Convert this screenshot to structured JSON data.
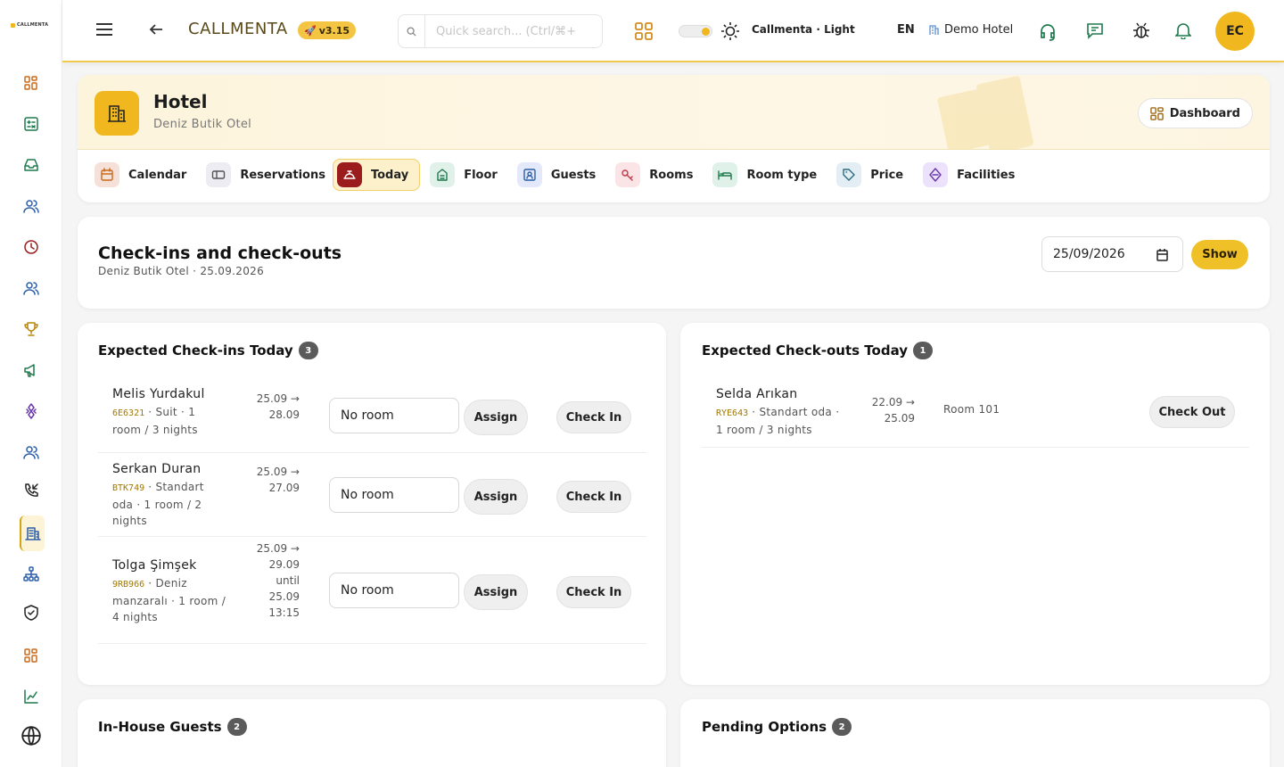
{
  "app": {
    "brand": "CALLMENTA",
    "version": "v3.15",
    "logo_text": "CALLMENTA"
  },
  "topbar": {
    "search_placeholder": "Quick search... (Ctrl/⌘+",
    "theme_label": "Callmenta · Light",
    "language": "EN",
    "hotel_label": "Demo Hotel",
    "avatar_initials": "EC",
    "icons": [
      "menu-icon",
      "back-arrow-icon",
      "search-icon",
      "apps-grid-icon",
      "theme-toggle",
      "sun-icon",
      "building-icon",
      "headset-icon",
      "chat-icon",
      "bug-icon",
      "bell-icon"
    ]
  },
  "sidebar": {
    "items": [
      "dashboard-icon",
      "spreadsheet-icon",
      "inbox-icon",
      "users-icon",
      "clock-icon",
      "team-icon",
      "trophy-icon",
      "megaphone-icon",
      "integration-icon",
      "contacts-icon",
      "phone-incoming-icon",
      "hotel-icon",
      "org-chart-icon",
      "shield-icon",
      "grid-icon",
      "chart-icon",
      "globe-icon"
    ],
    "active": "hotel-icon"
  },
  "hero": {
    "title": "Hotel",
    "subtitle": "Deniz Butik Otel",
    "dashboard_label": "Dashboard"
  },
  "tabs": [
    {
      "label": "Calendar",
      "icon": "calendar-icon",
      "color": "#f6e1d8"
    },
    {
      "label": "Reservations",
      "icon": "ticket-icon",
      "color": "#ececf2"
    },
    {
      "label": "Today",
      "icon": "bell-service-icon",
      "color": "#9b1c1c",
      "active": true
    },
    {
      "label": "Floor",
      "icon": "floor-icon",
      "color": "#e0f1ea"
    },
    {
      "label": "Guests",
      "icon": "id-card-icon",
      "color": "#e3e8fb"
    },
    {
      "label": "Rooms",
      "icon": "key-icon",
      "color": "#fbe4e6"
    },
    {
      "label": "Room type",
      "icon": "bed-icon",
      "color": "#e0f1ea"
    },
    {
      "label": "Price",
      "icon": "tag-icon",
      "color": "#e2eef3"
    },
    {
      "label": "Facilities",
      "icon": "diamond-icon",
      "color": "#ece2fb"
    }
  ],
  "header_card": {
    "title": "Check-ins and check-outs",
    "subtitle": "Deniz Butik Otel · 25.09.2026",
    "date_value": "25/09/2026",
    "show_label": "Show"
  },
  "checkins": {
    "title": "Expected Check-ins Today",
    "count": "3",
    "room_placeholder": "No room",
    "assign_label": "Assign",
    "checkin_label": "Check In",
    "rows": [
      {
        "name": "Melis Yurdakul",
        "code": "6E6321",
        "meta": " · Suit · 1 room / 3 nights",
        "dates": [
          "25.09 →",
          "28.09"
        ]
      },
      {
        "name": "Serkan Duran",
        "code": "BTK749",
        "meta": " · Standart oda · 1 room / 2 nights",
        "dates": [
          "25.09 →",
          "27.09"
        ]
      },
      {
        "name": "Tolga Şimşek",
        "code": "9RB966",
        "meta": " · Deniz manzaralı · 1 room / 4 nights",
        "dates": [
          "25.09 →",
          "29.09",
          "until",
          "25.09",
          "13:15"
        ]
      }
    ]
  },
  "checkouts": {
    "title": "Expected Check-outs Today",
    "count": "1",
    "checkout_label": "Check Out",
    "rows": [
      {
        "name": "Selda Arıkan",
        "code": "RYE643",
        "meta": " · Standart oda · 1 room / 3 nights",
        "dates": [
          "22.09 →",
          "25.09"
        ],
        "room": "Room 101"
      }
    ]
  },
  "inhouse": {
    "title": "In-House Guests",
    "count": "2"
  },
  "pending": {
    "title": "Pending Options",
    "count": "2"
  }
}
